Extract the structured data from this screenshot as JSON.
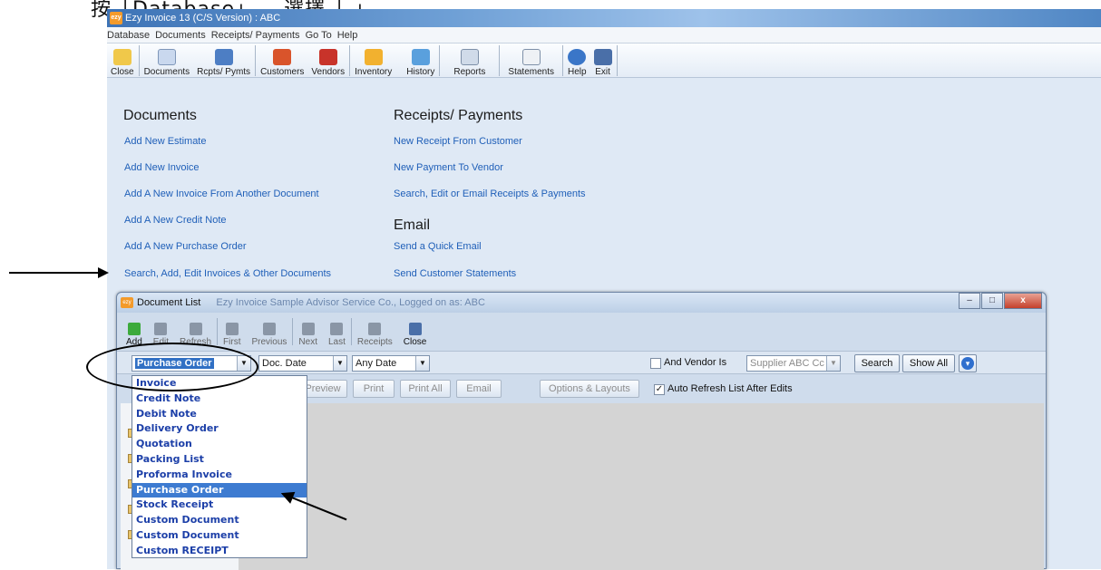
{
  "header_text": "按「Database」                                                               ，選擇「                        」",
  "app": {
    "title": "Ezy Invoice 13 (C/S Version) : ABC",
    "menu": [
      "Database",
      "Documents",
      "Receipts/ Payments",
      "Go To",
      "Help"
    ],
    "toolbar": [
      "Close",
      "Documents",
      "Rcpts/ Pymts",
      "Customers",
      "Vendors",
      "Inventory",
      "History",
      "Reports",
      "Statements",
      "Help",
      "Exit"
    ]
  },
  "documents_section": {
    "heading": "Documents",
    "links": [
      "Add New Estimate",
      "Add New Invoice",
      "Add A New Invoice From Another Document",
      "Add A New Credit Note",
      "Add A New Purchase Order",
      "Search, Add, Edit Invoices & Other Documents"
    ]
  },
  "receipts_section": {
    "heading": "Receipts/ Payments",
    "links": [
      "New Receipt From Customer",
      "New Payment To Vendor",
      "Search, Edit or Email Receipts & Payments"
    ]
  },
  "email_section": {
    "heading": "Email",
    "links": [
      "Send a Quick Email",
      "Send Customer Statements"
    ]
  },
  "doc_list": {
    "title": "Document List",
    "title_bg": "Ezy Invoice Sample Advisor Service Co., Logged on as: ABC",
    "toolbar": [
      "Add",
      "Edit",
      "Refresh",
      "First",
      "Previous",
      "Next",
      "Last",
      "Receipts",
      "Close"
    ],
    "doc_type_value": "Purchase Order",
    "date_field": "Doc. Date",
    "date_range": "Any Date",
    "vendor_check_label": "And Vendor Is",
    "vendor_value": "Supplier ABC Cc",
    "search_button": "Search",
    "show_all_button": "Show All",
    "actions": [
      "Preview",
      "Print",
      "Print All",
      "Email",
      "Options & Layouts"
    ],
    "auto_refresh_label": "Auto Refresh List After Edits",
    "auto_refresh_checked": "✓"
  },
  "dropdown_options": [
    "Invoice",
    "Credit Note",
    "Debit Note",
    "Delivery Order",
    "Quotation",
    "Packing List",
    "Proforma Invoice",
    "Purchase Order",
    "Stock Receipt",
    "Custom Document",
    "Custom Document",
    "Custom RECEIPT"
  ],
  "selected_option": "Purchase Order",
  "colors": {
    "link": "#1f5fb8",
    "dropdown_text": "#1c3fa8",
    "selection": "#3d7bd1"
  }
}
